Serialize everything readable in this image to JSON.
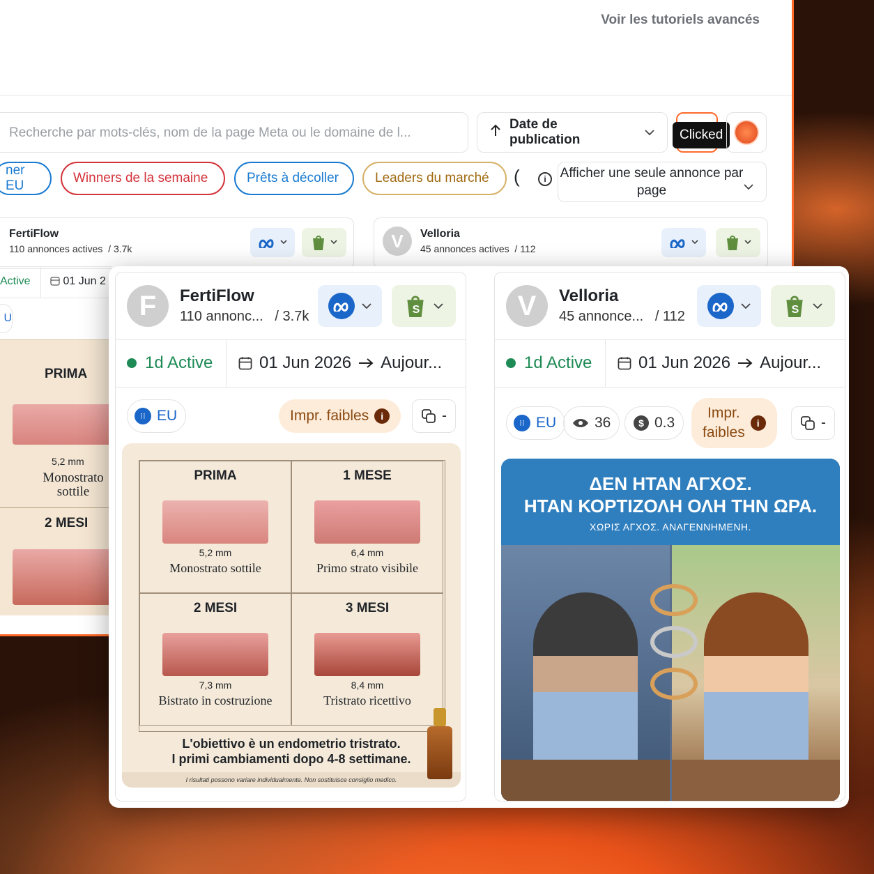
{
  "top_link": "Voir les tutoriels avancés",
  "search": {
    "placeholder": "Recherche par mots-clés, nom de la page Meta ou le domaine de l..."
  },
  "sort": {
    "label": "Date de publication"
  },
  "tooltip": "Clicked",
  "filters": {
    "chips": [
      "ner EU",
      "Winners de la semaine",
      "Prêts à décoller",
      "Leaders du marché"
    ],
    "paren": "(",
    "display_mode": "Afficher une seule annonce par page"
  },
  "back_cards": [
    {
      "name": "FertiFlow",
      "sub": "110 annonces actives",
      "count": "/ 3.7k",
      "active": "Active",
      "date": "01 Jun 2",
      "region": "U"
    },
    {
      "name": "Velloria",
      "sub": "45 annonces actives",
      "count": "/ 112"
    }
  ],
  "back_creative": {
    "label_top": "PRIMA",
    "mm": "5,2 mm",
    "caption": "Monostrato sottile",
    "label_bottom": "2 MESI"
  },
  "cards": [
    {
      "avatar": "F",
      "name": "FertiFlow",
      "sub": "110 annonc...",
      "count": "/ 3.7k",
      "active": "1d Active",
      "date_from": "01 Jun 2026",
      "date_to": "Aujour...",
      "region": "EU",
      "impressions": "Impr. faibles",
      "copy_count": "-",
      "creative": {
        "cells": [
          {
            "title": "PRIMA",
            "mm": "5,2 mm",
            "caption": "Monostrato sottile"
          },
          {
            "title": "1 MESE",
            "mm": "6,4 mm",
            "caption": "Primo strato visibile"
          },
          {
            "title": "2 MESI",
            "mm": "7,3 mm",
            "caption": "Bistrato in costruzione"
          },
          {
            "title": "3 MESI",
            "mm": "8,4 mm",
            "caption": "Tristrato ricettivo"
          }
        ],
        "footer_line1": "L'obiettivo è un endometrio tristrato.",
        "footer_line2": "I primi cambiamenti dopo 4-8 settimane.",
        "disclaimer": "I risultati possono variare individualmente. Non sostituisce consiglio medico."
      }
    },
    {
      "avatar": "V",
      "name": "Velloria",
      "sub": "45 annonce...",
      "count": "/ 112",
      "active": "1d Active",
      "date_from": "01 Jun 2026",
      "date_to": "Aujour...",
      "region": "EU",
      "views": "36",
      "spend": "0.3",
      "impressions_line1": "Impr.",
      "impressions_line2": "faibles",
      "copy_count": "-",
      "creative": {
        "headline1": "ΔΕΝ ΗΤΑΝ ΑΓΧΟΣ.",
        "headline2": "ΗΤΑΝ ΚΟΡΤΙΖΟΛΗ ΟΛΗ ΤΗΝ ΩΡΑ.",
        "subline": "ΧΩΡΙΣ ΑΓΧΟΣ. ΑΝΑΓΕΝΝΗΜΕΝΗ."
      }
    }
  ],
  "colors": {
    "accent": "#ff6a2a",
    "active_green": "#1e8a55",
    "meta_blue": "#1a66c9",
    "shopify_green": "#5e8e3e"
  }
}
